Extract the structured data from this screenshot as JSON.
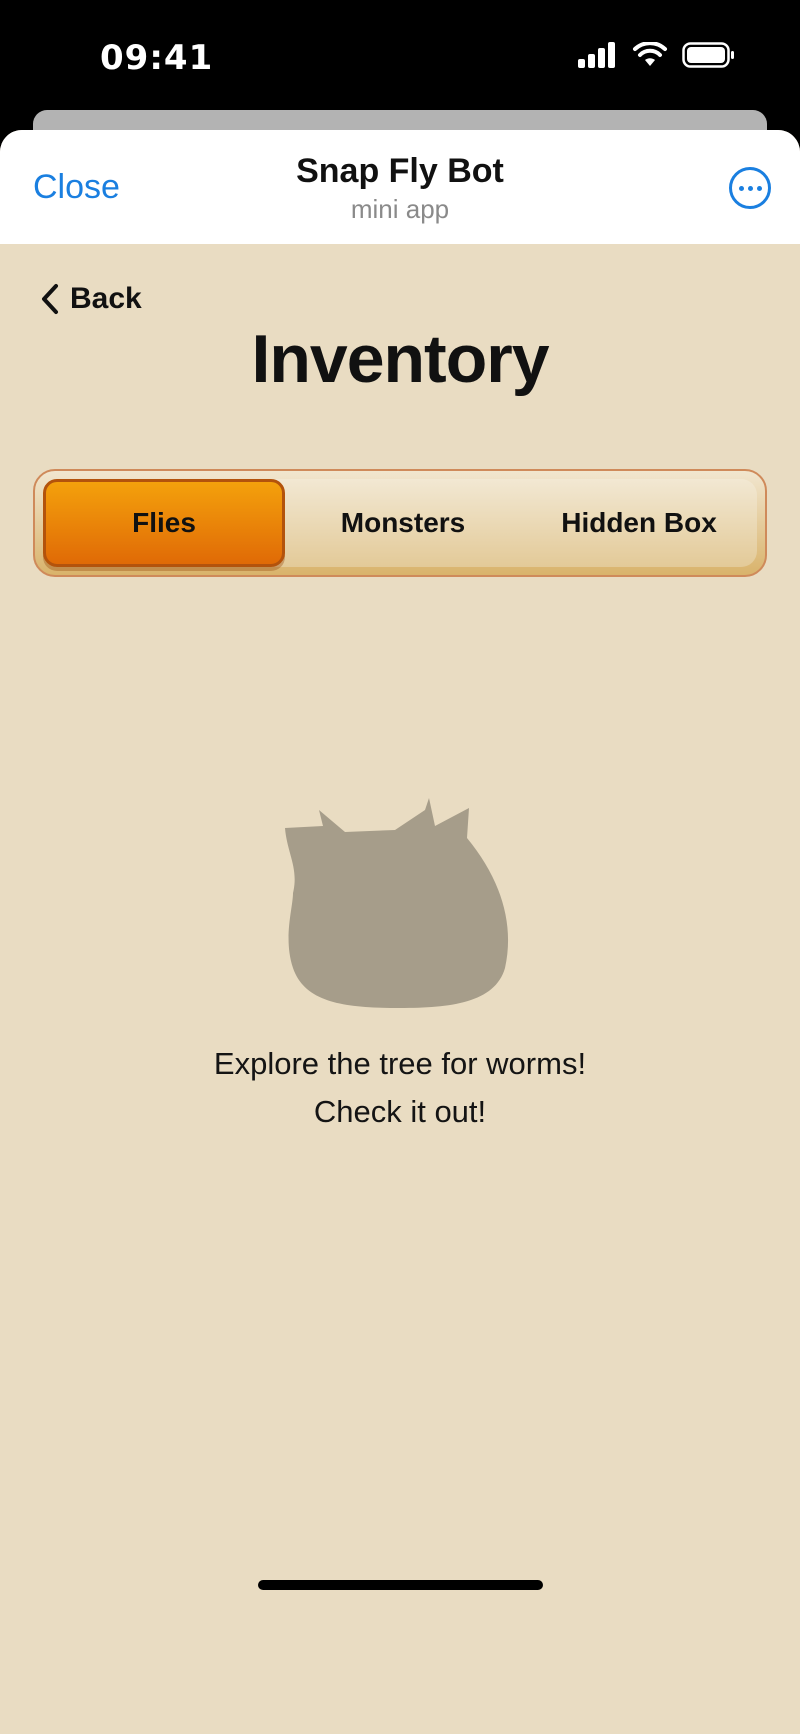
{
  "status_bar": {
    "time": "09:41"
  },
  "header": {
    "close_label": "Close",
    "title": "Snap Fly Bot",
    "subtitle": "mini app"
  },
  "nav": {
    "back_label": "Back"
  },
  "page": {
    "title": "Inventory"
  },
  "tabs": [
    {
      "label": "Flies",
      "active": true
    },
    {
      "label": "Monsters",
      "active": false
    },
    {
      "label": "Hidden Box",
      "active": false
    }
  ],
  "empty_state": {
    "line1": "Explore the tree for worms!",
    "line2": "Check it out!"
  },
  "colors": {
    "accent": "#1a7fe0",
    "background": "#e9dcc2",
    "active_tab": "#f08a06",
    "silhouette": "#a69d8a"
  }
}
